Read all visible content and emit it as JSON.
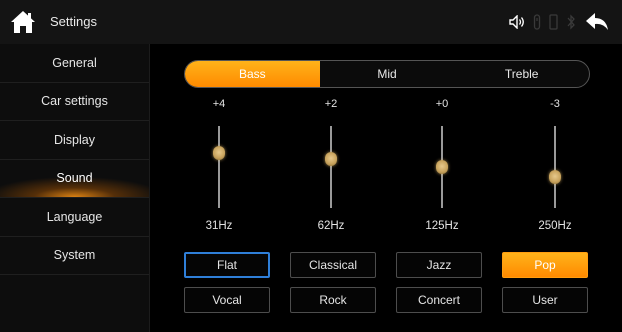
{
  "header": {
    "title": "Settings",
    "icons": [
      "home-icon",
      "volume-icon",
      "usb-icon",
      "phone-icon",
      "bluetooth-icon",
      "back-icon"
    ]
  },
  "sidebar": {
    "items": [
      {
        "label": "General"
      },
      {
        "label": "Car settings"
      },
      {
        "label": "Display"
      },
      {
        "label": "Sound",
        "active": true
      },
      {
        "label": "Language"
      },
      {
        "label": "System"
      }
    ]
  },
  "tabs": [
    {
      "label": "Bass",
      "active": true
    },
    {
      "label": "Mid"
    },
    {
      "label": "Treble"
    }
  ],
  "equalizer": {
    "bands": [
      {
        "gain": "+4",
        "freq": "31Hz",
        "level": 0.33
      },
      {
        "gain": "+2",
        "freq": "62Hz",
        "level": 0.4
      },
      {
        "gain": "+0",
        "freq": "125Hz",
        "level": 0.5
      },
      {
        "gain": "-3",
        "freq": "250Hz",
        "level": 0.62
      }
    ]
  },
  "presets": [
    {
      "label": "Flat",
      "focused": true
    },
    {
      "label": "Classical"
    },
    {
      "label": "Jazz"
    },
    {
      "label": "Pop",
      "active": true
    },
    {
      "label": "Vocal"
    },
    {
      "label": "Rock"
    },
    {
      "label": "Concert"
    },
    {
      "label": "User"
    }
  ],
  "colors": {
    "accent": "#ff9d10",
    "focus_outline": "#2f7fd8",
    "background": "#000000"
  }
}
